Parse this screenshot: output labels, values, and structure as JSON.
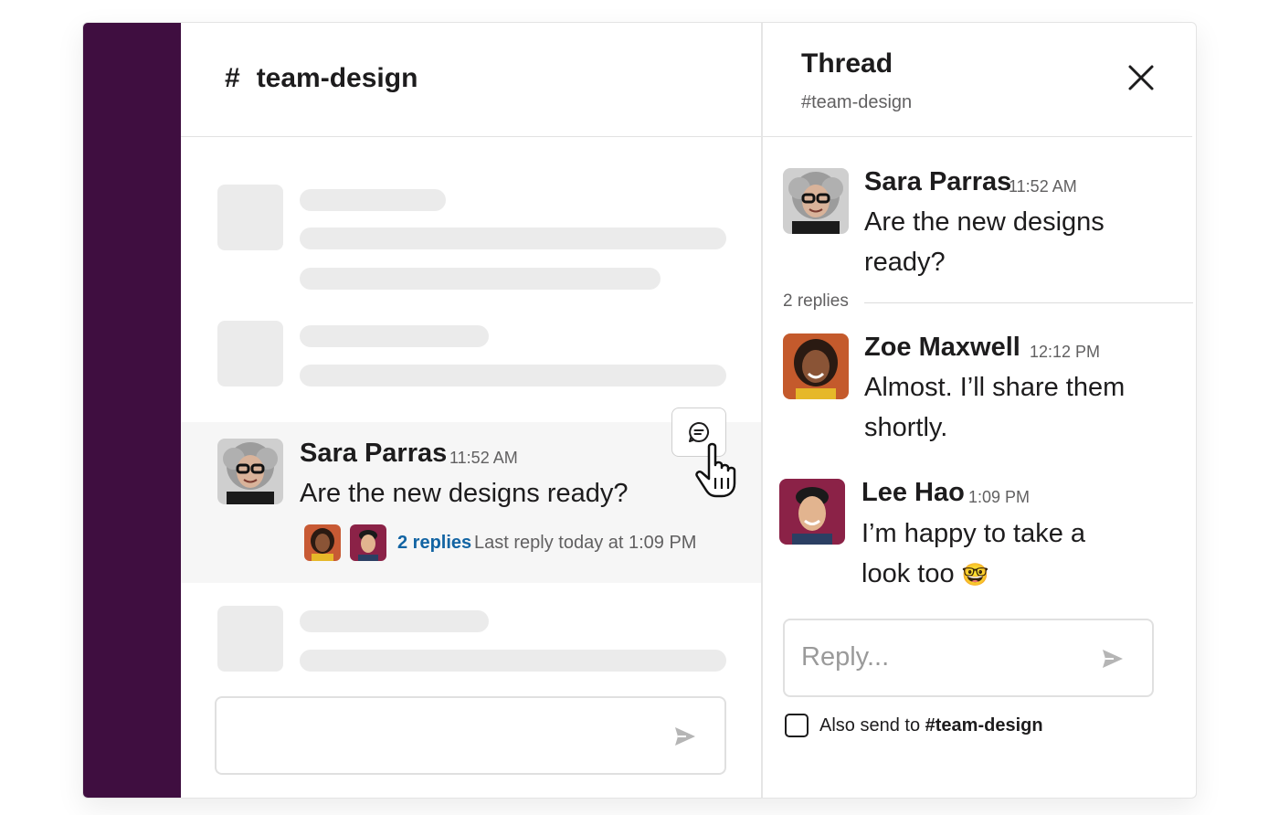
{
  "channel": {
    "hash": "#",
    "name": "team-design"
  },
  "message": {
    "author": "Sara Parras",
    "time": "11:52 AM",
    "text": "Are the new designs ready?",
    "replies_link": "2 replies",
    "last_reply": "Last reply today at 1:09 PM"
  },
  "thread": {
    "title": "Thread",
    "channel": "#team-design",
    "replies_count": "2 replies",
    "messages": [
      {
        "author": "Sara Parras",
        "time": "11:52 AM",
        "line1": "Are the new designs",
        "line2": "ready?"
      },
      {
        "author": "Zoe Maxwell",
        "time": "12:12 PM",
        "line1": "Almost. I’ll share them",
        "line2": "shortly."
      },
      {
        "author": "Lee Hao",
        "time": "1:09 PM",
        "line1": "I’m happy to take a",
        "line2": "look too",
        "emoji": "🤓"
      }
    ],
    "reply_placeholder": "Reply...",
    "also_send_prefix": "Also send to",
    "also_send_channel": "#team-design"
  },
  "icons": {
    "close": "close-icon",
    "send": "send-icon",
    "thread_action": "reply-in-thread-icon",
    "cursor": "hand-pointer-icon"
  },
  "colors": {
    "sidebar": "#3f0e40",
    "link": "#1264a3",
    "highlight": "#f6f6f6",
    "skeleton": "#ebebeb"
  }
}
